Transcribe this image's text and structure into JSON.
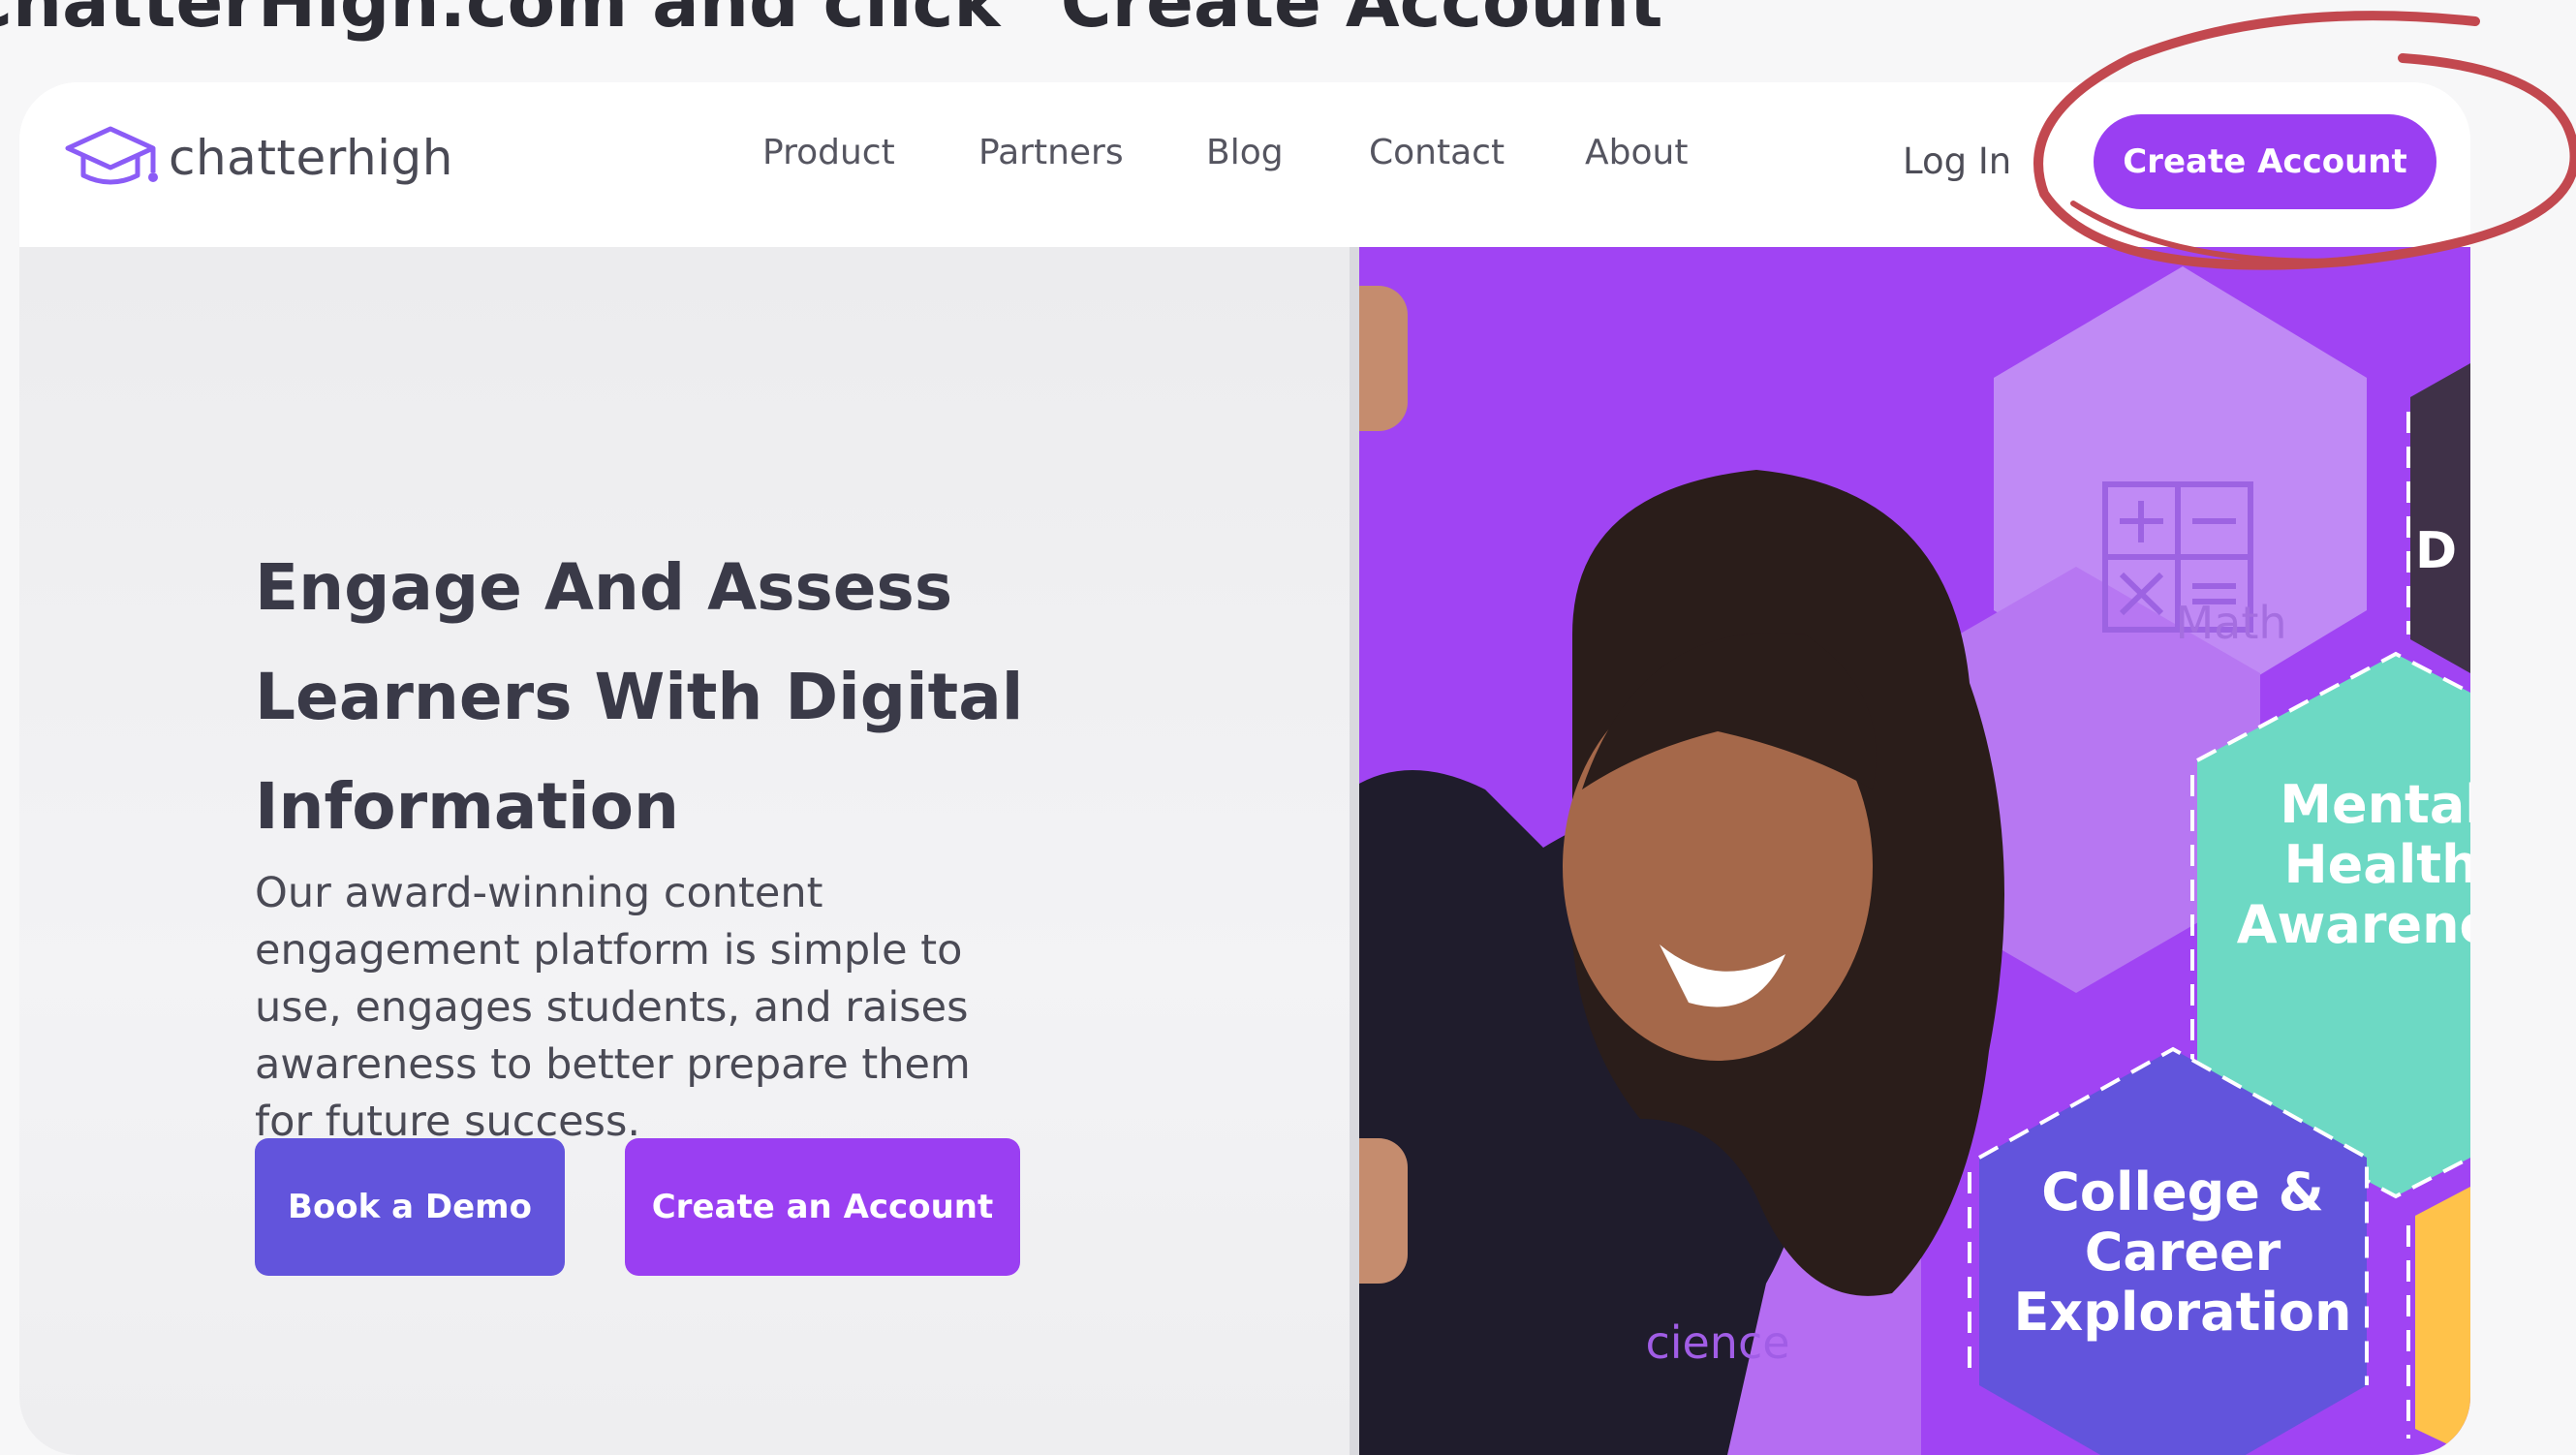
{
  "instruction_text": "ChatterHigh.com and click \"Create Account\"",
  "brand": {
    "name": "chatterhigh",
    "logo_icon": "graduation-cap-icon",
    "accent": "#9a3ff2",
    "secondary": "#6254dc"
  },
  "nav": {
    "links": [
      "Product",
      "Partners",
      "Blog",
      "Contact",
      "About"
    ],
    "login_label": "Log In",
    "create_account_label": "Create Account"
  },
  "hero": {
    "headline": "Engage And Assess Learners With Digital Information",
    "subtext": "Our award-winning content engagement platform is simple to use, engages students, and raises awareness to better prepare them for future success.",
    "demo_button": "Book a Demo",
    "create_button": "Create an Account"
  },
  "topics": {
    "math": "Math",
    "mental": "Mental Health Awarenes",
    "college": "College & Career Exploration",
    "science": "cience",
    "d_partial": "D"
  }
}
